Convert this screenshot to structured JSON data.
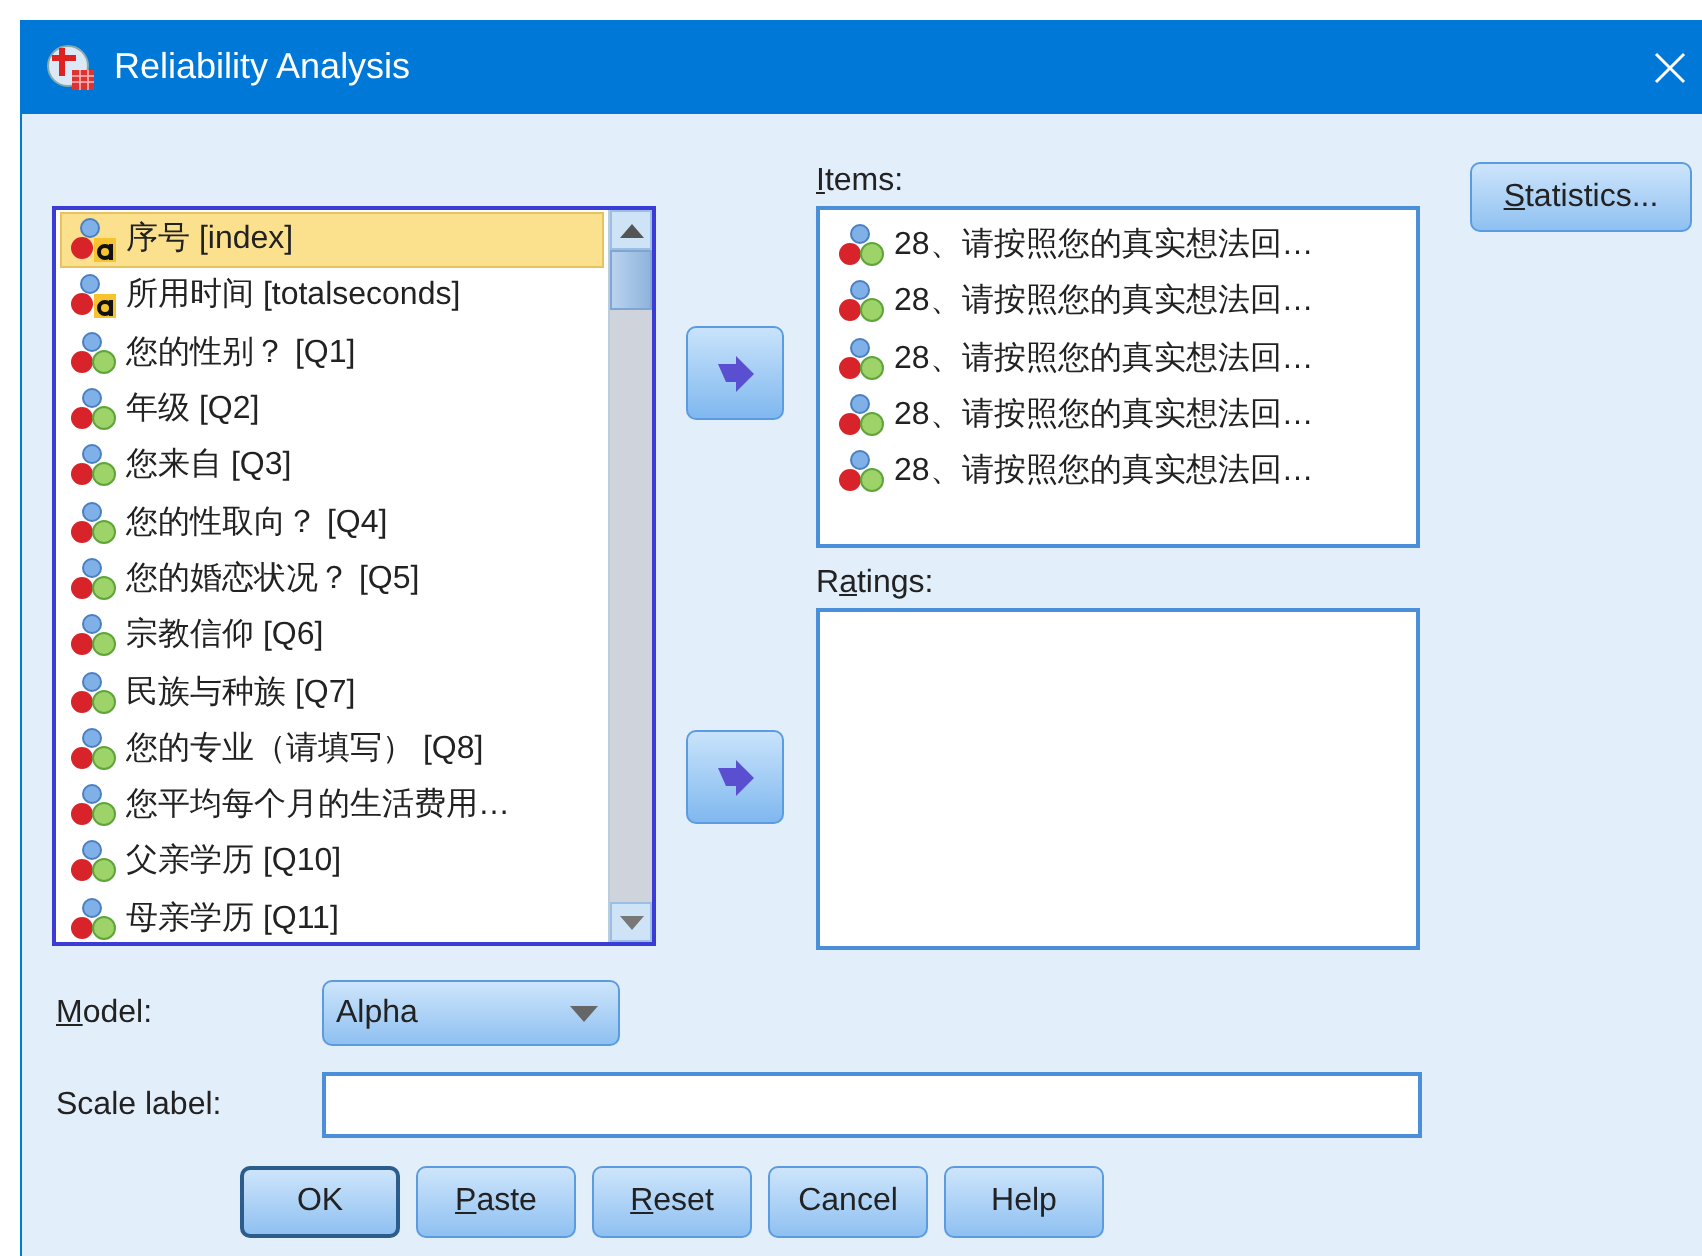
{
  "window": {
    "title": "Reliability Analysis"
  },
  "variables": [
    {
      "label": "序号 [index]",
      "kind": "string",
      "selected": true
    },
    {
      "label": "所用时间 [totalseconds]",
      "kind": "string",
      "selected": false
    },
    {
      "label": "您的性别？ [Q1]",
      "kind": "nominal",
      "selected": false
    },
    {
      "label": "年级 [Q2]",
      "kind": "nominal",
      "selected": false
    },
    {
      "label": "您来自 [Q3]",
      "kind": "nominal",
      "selected": false
    },
    {
      "label": "您的性取向？ [Q4]",
      "kind": "nominal",
      "selected": false
    },
    {
      "label": "您的婚恋状况？ [Q5]",
      "kind": "nominal",
      "selected": false
    },
    {
      "label": "宗教信仰 [Q6]",
      "kind": "nominal",
      "selected": false
    },
    {
      "label": "民族与种族 [Q7]",
      "kind": "nominal",
      "selected": false
    },
    {
      "label": "您的专业（请填写） [Q8]",
      "kind": "nominal",
      "selected": false
    },
    {
      "label": "您平均每个月的生活费用…",
      "kind": "nominal",
      "selected": false
    },
    {
      "label": "父亲学历 [Q10]",
      "kind": "nominal",
      "selected": false
    },
    {
      "label": "母亲学历 [Q11]",
      "kind": "nominal",
      "selected": false
    }
  ],
  "items": {
    "label": [
      {
        "text": "I",
        "underlined": true
      },
      {
        "text": "tems:",
        "underlined": false
      }
    ],
    "entries": [
      {
        "label": "28、请按照您的真实想法回…",
        "kind": "nominal"
      },
      {
        "label": "28、请按照您的真实想法回…",
        "kind": "nominal"
      },
      {
        "label": "28、请按照您的真实想法回…",
        "kind": "nominal"
      },
      {
        "label": "28、请按照您的真实想法回…",
        "kind": "nominal"
      },
      {
        "label": "28、请按照您的真实想法回…",
        "kind": "nominal"
      }
    ]
  },
  "ratings": {
    "label": [
      {
        "text": "R",
        "underlined": false
      },
      {
        "text": "a",
        "underlined": true
      },
      {
        "text": "tings:",
        "underlined": false
      }
    ]
  },
  "statistics_button": {
    "label": [
      {
        "text": "S",
        "underlined": true
      },
      {
        "text": "tatistics...",
        "underlined": false
      }
    ]
  },
  "model": {
    "label": [
      {
        "text": "M",
        "underlined": true
      },
      {
        "text": "odel:",
        "underlined": false
      }
    ],
    "value": "Alpha"
  },
  "scale_label": {
    "label": [
      {
        "text": "Scale label:",
        "underlined": false
      }
    ]
  },
  "buttons": [
    {
      "label": [
        {
          "text": "OK",
          "underlined": false
        }
      ],
      "default": true
    },
    {
      "label": [
        {
          "text": "P",
          "underlined": true
        },
        {
          "text": "aste",
          "underlined": false
        }
      ],
      "default": false
    },
    {
      "label": [
        {
          "text": "R",
          "underlined": true
        },
        {
          "text": "eset",
          "underlined": false
        }
      ],
      "default": false
    },
    {
      "label": [
        {
          "text": "Cancel",
          "underlined": false
        }
      ],
      "default": false
    },
    {
      "label": [
        {
          "text": "Help",
          "underlined": false
        }
      ],
      "default": false
    }
  ]
}
